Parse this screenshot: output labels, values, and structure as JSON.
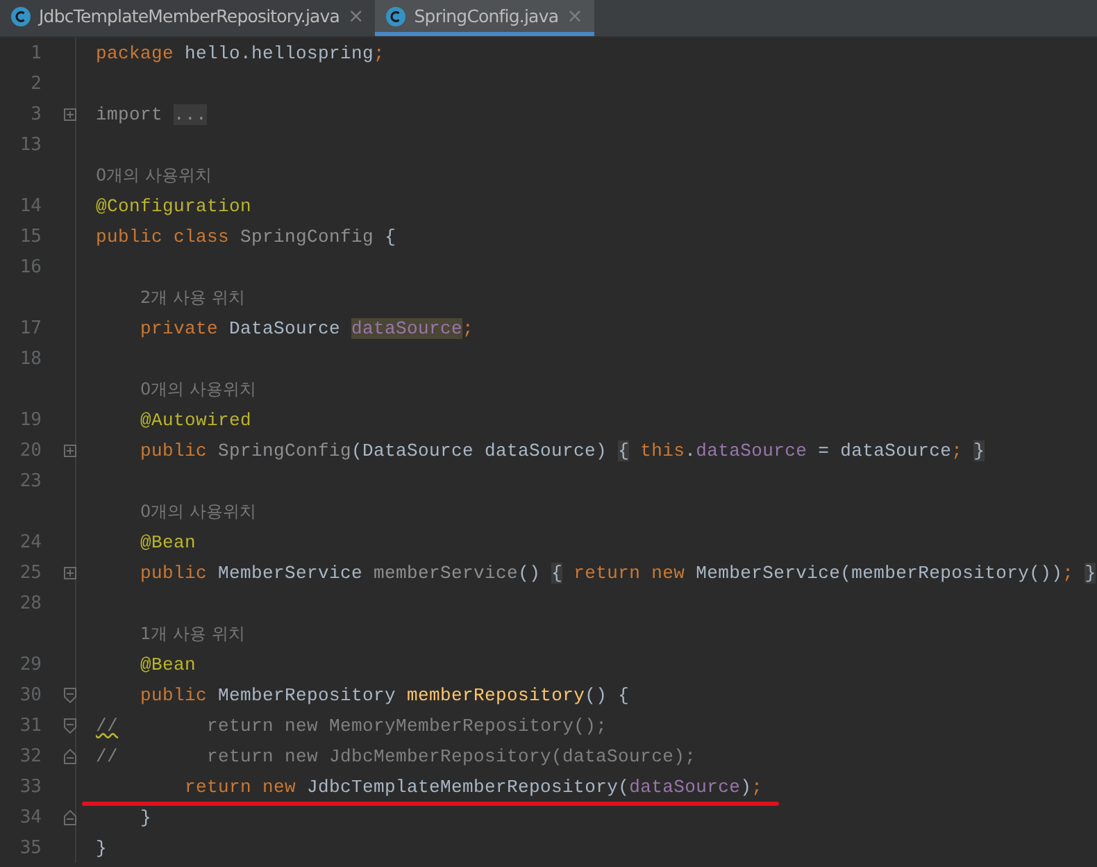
{
  "tabs": [
    {
      "label": "JdbcTemplateMemberRepository.java",
      "close": "×",
      "selected": false
    },
    {
      "label": "SpringConfig.java",
      "close": "×",
      "selected": true
    }
  ],
  "lines": [
    {
      "number": "1",
      "tokens": [
        {
          "kind": "kw",
          "s": "package "
        },
        {
          "kind": "plain",
          "s": "hello.hellospring"
        },
        {
          "kind": "kw",
          "s": ";"
        }
      ]
    },
    {
      "number": "2"
    },
    {
      "number": "3",
      "fold": {
        "kind": "plus"
      },
      "tokens": [
        {
          "kind": "dim",
          "s": "import "
        },
        {
          "kind": "dim",
          "s": "...",
          "boxed": true
        }
      ]
    },
    {
      "number": "13"
    },
    {
      "number": "14",
      "usage": "0개의 사용위치",
      "tokens": [
        {
          "kind": "anno",
          "s": "@Configuration"
        }
      ]
    },
    {
      "number": "15",
      "tokens": [
        {
          "kind": "kw",
          "s": "public class "
        },
        {
          "kind": "unused",
          "s": "SpringConfig "
        },
        {
          "kind": "plain",
          "s": "{"
        }
      ]
    },
    {
      "number": "16"
    },
    {
      "number": "17",
      "usage": "2개 사용 위치",
      "tokens": [
        {
          "kind": "kw",
          "s": "    private "
        },
        {
          "kind": "plain",
          "s": "DataSource "
        },
        {
          "kind": "field",
          "s": "dataSource",
          "highlighted": true
        },
        {
          "kind": "kw",
          "s": ";"
        }
      ]
    },
    {
      "number": "18"
    },
    {
      "number": "19",
      "usage": "0개의 사용위치",
      "tokens": [
        {
          "kind": "anno",
          "s": "    @Autowired"
        }
      ]
    },
    {
      "number": "20",
      "fold": {
        "kind": "plus"
      },
      "tokens": [
        {
          "kind": "kw",
          "s": "    public "
        },
        {
          "kind": "unused",
          "s": "SpringConfig"
        },
        {
          "kind": "plain",
          "s": "(DataSource dataSource) "
        },
        {
          "kind": "plain",
          "s": "{",
          "boxed": true
        },
        {
          "kind": "kw",
          "s": " this"
        },
        {
          "kind": "plain",
          "s": "."
        },
        {
          "kind": "field",
          "s": "dataSource"
        },
        {
          "kind": "plain",
          "s": " = dataSource"
        },
        {
          "kind": "kw",
          "s": "; "
        },
        {
          "kind": "plain",
          "s": "}",
          "boxed": true
        }
      ]
    },
    {
      "number": "23"
    },
    {
      "number": "24",
      "usage": "0개의 사용위치",
      "tokens": [
        {
          "kind": "anno",
          "s": "    @Bean"
        }
      ]
    },
    {
      "number": "25",
      "fold": {
        "kind": "plus"
      },
      "tokens": [
        {
          "kind": "kw",
          "s": "    public "
        },
        {
          "kind": "plain",
          "s": "MemberService "
        },
        {
          "kind": "unused",
          "s": "memberService"
        },
        {
          "kind": "plain",
          "s": "() "
        },
        {
          "kind": "plain",
          "s": "{",
          "boxed": true
        },
        {
          "kind": "kw",
          "s": " return new "
        },
        {
          "kind": "plain",
          "s": "MemberService(memberRepository())"
        },
        {
          "kind": "kw",
          "s": "; "
        },
        {
          "kind": "plain",
          "s": "}",
          "boxed": true
        }
      ]
    },
    {
      "number": "28"
    },
    {
      "number": "29",
      "usage": "1개 사용 위치",
      "tokens": [
        {
          "kind": "anno",
          "s": "    @Bean"
        }
      ]
    },
    {
      "number": "30",
      "fold": {
        "kind": "open"
      },
      "tokens": [
        {
          "kind": "kw",
          "s": "    public "
        },
        {
          "kind": "plain",
          "s": "MemberRepository "
        },
        {
          "kind": "method",
          "s": "memberRepository"
        },
        {
          "kind": "plain",
          "s": "() {"
        }
      ]
    },
    {
      "number": "31",
      "fold": {
        "kind": "open"
      },
      "tokens": [
        {
          "kind": "comment",
          "s": "//",
          "squiggle": true
        },
        {
          "kind": "comment",
          "s": "        return new MemoryMemberRepository();"
        }
      ]
    },
    {
      "number": "32",
      "fold": {
        "kind": "close"
      },
      "tokens": [
        {
          "kind": "comment",
          "s": "//        return new JdbcMemberRepository(dataSource);"
        }
      ]
    },
    {
      "number": "33",
      "underlined": true,
      "tokens": [
        {
          "kind": "kw",
          "s": "        return new "
        },
        {
          "kind": "plain",
          "s": "JdbcTemplateMemberRepository("
        },
        {
          "kind": "field",
          "s": "dataSource"
        },
        {
          "kind": "plain",
          "s": ")"
        },
        {
          "kind": "kw",
          "s": ";"
        }
      ]
    },
    {
      "number": "34",
      "fold": {
        "kind": "close"
      },
      "tokens": [
        {
          "kind": "plain",
          "s": "    }"
        }
      ]
    },
    {
      "number": "35",
      "tokens": [
        {
          "kind": "plain",
          "s": "}"
        }
      ]
    }
  ]
}
